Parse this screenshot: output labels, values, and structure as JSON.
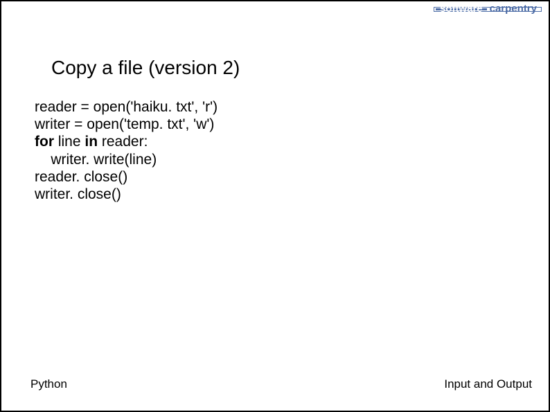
{
  "logo": {
    "word1": "software",
    "word2": "carpentry"
  },
  "title": "Copy a file (version 2)",
  "code": {
    "line1_pre": "reader = open('haiku. txt', 'r')",
    "line2_pre": "writer = open('temp. txt', 'w')",
    "line3_kw1": "for",
    "line3_mid": " line ",
    "line3_kw2": "in",
    "line3_post": " reader:",
    "line4": "    writer. write(line)",
    "line5": "reader. close()",
    "line6": "writer. close()"
  },
  "footer": {
    "left": "Python",
    "right": "Input and Output"
  }
}
